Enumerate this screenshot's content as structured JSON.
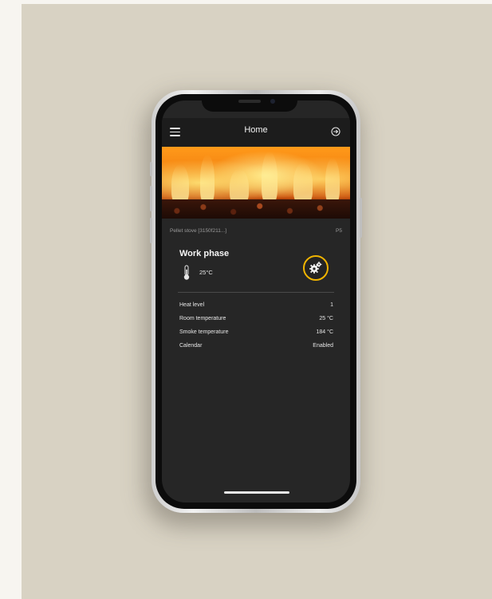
{
  "app": {
    "header": {
      "title": "Home"
    },
    "device": {
      "name": "Pellet stove [3150f211...]",
      "code": "P5"
    },
    "status": {
      "phase": "Work phase",
      "temperature": "25°C"
    },
    "details": [
      {
        "label": "Heat level",
        "value": "1"
      },
      {
        "label": "Room temperature",
        "value": "25 °C"
      },
      {
        "label": "Smoke temperature",
        "value": "184 °C"
      },
      {
        "label": "Calendar",
        "value": "Enabled"
      }
    ]
  },
  "colors": {
    "accent": "#f0b400",
    "background": "#262626",
    "header": "#1c1c1c",
    "backdrop": "#d8d2c3"
  },
  "icons": [
    "menu-icon",
    "logout-icon",
    "thermometer-icon",
    "gear-icon"
  ]
}
